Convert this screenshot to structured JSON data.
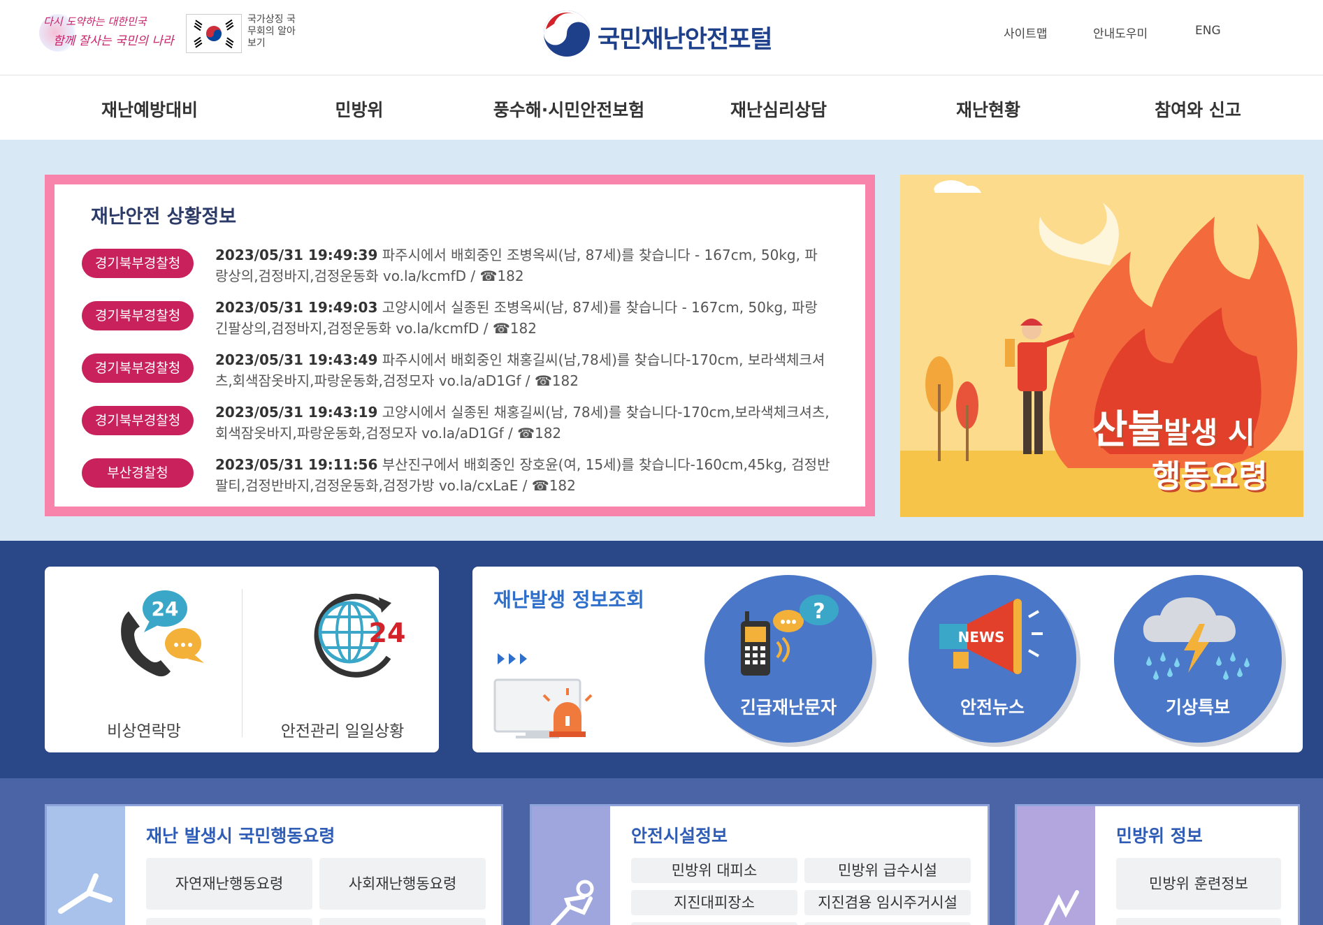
{
  "header": {
    "slogan_line1": "다시 도약하는 대한민국",
    "slogan_line2": "함께 잘사는 국민의 나라",
    "flag_link": "국가상징 국무회의 알아보기",
    "site_title": "국민재난안전포털",
    "util_links": [
      "사이트맵",
      "안내도우미",
      "ENG"
    ]
  },
  "nav": {
    "items": [
      "재난예방대비",
      "민방위",
      "풍수해·시민안전보험",
      "재난심리상담",
      "재난현황",
      "참여와 신고"
    ]
  },
  "status": {
    "title": "재난안전 상황정보",
    "alerts": [
      {
        "agency": "경기북부경찰청",
        "time": "2023/05/31 19:49:39",
        "message": "파주시에서 배회중인 조병옥씨(남, 87세)를 찾습니다 - 167cm, 50kg, 파랑상의,검정바지,검정운동화 vo.la/kcmfD / ☎182"
      },
      {
        "agency": "경기북부경찰청",
        "time": "2023/05/31 19:49:03",
        "message": "고양시에서 실종된 조병옥씨(남, 87세)를 찾습니다 - 167cm, 50kg, 파랑긴팔상의,검정바지,검정운동화 vo.la/kcmfD / ☎182"
      },
      {
        "agency": "경기북부경찰청",
        "time": "2023/05/31 19:43:49",
        "message": "파주시에서 배회중인 채홍길씨(남,78세)를 찾습니다-170cm, 보라색체크셔츠,회색잠옷바지,파랑운동화,검정모자 vo.la/aD1Gf / ☎182"
      },
      {
        "agency": "경기북부경찰청",
        "time": "2023/05/31 19:43:19",
        "message": "고양시에서 실종된 채홍길씨(남, 78세)를 찾습니다-170cm,보라색체크셔츠, 회색잠옷바지,파랑운동화,검정모자 vo.la/aD1Gf / ☎182"
      },
      {
        "agency": "부산경찰청",
        "time": "2023/05/31 19:11:56",
        "message": "부산진구에서 배회중인 장호윤(여, 15세)를 찾습니다-160cm,45kg, 검정반팔티,검정반바지,검정운동화,검정가방 vo.la/cxLaE / ☎182"
      }
    ]
  },
  "banner": {
    "line1_a": "산불",
    "line1_b": "발생 시",
    "line2": "행동요령"
  },
  "quick_links": [
    {
      "label": "비상연락망",
      "icon": "phone-24-chat-icon"
    },
    {
      "label": "안전관리 일일상황",
      "icon": "globe-24-icon"
    }
  ],
  "disaster_info": {
    "title": "재난발생 정보조회",
    "circles": [
      {
        "label": "긴급재난문자",
        "icon": "walkie-talkie-icon"
      },
      {
        "label": "안전뉴스",
        "icon": "megaphone-news-icon",
        "news_text": "NEWS"
      },
      {
        "label": "기상특보",
        "icon": "storm-cloud-icon"
      }
    ]
  },
  "panels": [
    {
      "title": "재난 발생시 국민행동요령",
      "buttons": [
        "자연재난행동요령",
        "사회재난행동요령"
      ]
    },
    {
      "title": "안전시설정보",
      "buttons": [
        "민방위 대피소",
        "민방위 급수시설",
        "지진대피장소",
        "지진겸용 임시주거시설"
      ]
    },
    {
      "title": "민방위 정보",
      "buttons": [
        "민방위 훈련정보"
      ]
    }
  ],
  "colors": {
    "brand_navy": "#1e3f8a",
    "badge_red": "#c9215b",
    "pink_border": "#f884ac",
    "section_blue": "#2a4788",
    "circle_blue": "#4a77c7"
  }
}
